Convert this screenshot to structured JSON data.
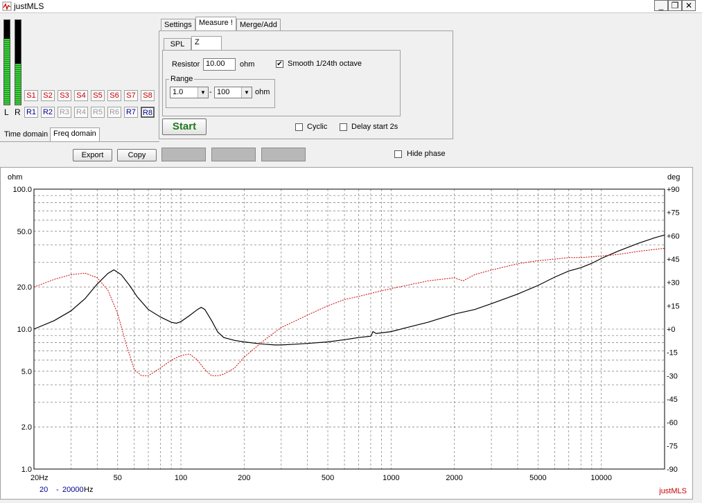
{
  "window": {
    "title": "justMLS",
    "min": "_",
    "max": "❐",
    "close": "✕"
  },
  "meters": {
    "left_label": "L",
    "right_label": "R",
    "left_level": 0.78,
    "right_level": 0.48
  },
  "sweep_buttons": [
    "S1",
    "S2",
    "S3",
    "S4",
    "S5",
    "S6",
    "S7",
    "S8"
  ],
  "ref_buttons": [
    "R1",
    "R2",
    "R3",
    "R4",
    "R5",
    "R6",
    "R7",
    "R8"
  ],
  "view_tabs": {
    "time": "Time domain",
    "freq": "Freq domain"
  },
  "main_tabs": {
    "settings": "Settings",
    "measure": "Measure !",
    "merge": "Merge/Add"
  },
  "sub_tabs": {
    "spl": "SPL",
    "z": "Z"
  },
  "z_panel": {
    "resistor_label": "Resistor",
    "resistor_value": "10.00",
    "resistor_unit": "ohm",
    "smooth_label": "Smooth 1/24th octave",
    "smooth_checked": "✔",
    "range_label": "Range",
    "range_min": "1.0",
    "range_dash": "-",
    "range_max": "100",
    "range_unit": "ohm"
  },
  "start_label": "Start",
  "cyclic_label": "Cyclic",
  "delay_label": "Delay start 2s",
  "export_label": "Export",
  "copy_label": "Copy",
  "hide_phase_label": "Hide phase",
  "plot": {
    "left_unit": "ohm",
    "right_unit": "deg",
    "y_ticks": [
      "100.0",
      "50.0",
      "20.0",
      "10.0",
      "5.0",
      "2.0",
      "1.0"
    ],
    "phase_ticks": [
      "+90",
      "+75",
      "+60",
      "+45",
      "+30",
      "+15",
      "+0",
      "-15",
      "-30",
      "-45",
      "-60",
      "-75",
      "-90"
    ],
    "x_ticks": [
      "20Hz",
      "50",
      "100",
      "200",
      "500",
      "1000",
      "2000",
      "5000",
      "10000"
    ],
    "range_from": "20",
    "range_dash": "-",
    "range_to": "20000",
    "range_unit": "Hz",
    "brand": "justMLS"
  },
  "colors": {
    "impedance": "#000000",
    "phase": "#cc0000",
    "accent_green": "#1e7a1e"
  },
  "chart_data": {
    "type": "line",
    "xlabel": "",
    "ylabel": "ohm",
    "y2label": "deg",
    "xscale": "log",
    "yscale": "log",
    "xlim": [
      20,
      20000
    ],
    "ylim": [
      1,
      100
    ],
    "y2lim": [
      -90,
      90
    ],
    "grid": true,
    "series": [
      {
        "axis": "left",
        "x": [
          20,
          25,
          30,
          35,
          40,
          45,
          48,
          52,
          57,
          62,
          70,
          80,
          90,
          95,
          100,
          110,
          120,
          125,
          130,
          140,
          150,
          160,
          180,
          200,
          230,
          250,
          280,
          300,
          350,
          400,
          500,
          600,
          700,
          800,
          820,
          850,
          900,
          1000,
          1200,
          1500,
          2000,
          2500,
          3000,
          4000,
          5000,
          6000,
          7000,
          8000,
          9000,
          10000,
          12000,
          15000,
          18000,
          20000
        ],
        "y": [
          10.0,
          11.5,
          13.5,
          16.5,
          21.0,
          25.0,
          26.5,
          24.5,
          20.5,
          17.0,
          13.8,
          12.2,
          11.2,
          11.0,
          11.3,
          12.5,
          13.8,
          14.3,
          13.8,
          11.5,
          9.5,
          8.7,
          8.3,
          8.1,
          7.9,
          7.8,
          7.7,
          7.7,
          7.8,
          7.9,
          8.1,
          8.4,
          8.7,
          8.9,
          9.6,
          9.3,
          9.4,
          9.6,
          10.3,
          11.2,
          12.8,
          13.8,
          15.2,
          17.8,
          20.5,
          23.5,
          26.0,
          27.5,
          29.5,
          32.0,
          36.0,
          41.0,
          45.0,
          47.0
        ]
      },
      {
        "axis": "right",
        "x": [
          20,
          25,
          30,
          35,
          40,
          45,
          50,
          55,
          60,
          65,
          70,
          80,
          90,
          100,
          110,
          120,
          130,
          140,
          150,
          160,
          180,
          200,
          250,
          300,
          400,
          500,
          600,
          700,
          800,
          1000,
          1500,
          2000,
          2200,
          2500,
          3000,
          4000,
          5000,
          6000,
          7000,
          8000,
          10000,
          12000,
          15000,
          20000
        ],
        "y": [
          27,
          32,
          35,
          36,
          33,
          25,
          10,
          -10,
          -26,
          -30,
          -30,
          -25,
          -20,
          -17,
          -16,
          -20,
          -26,
          -30,
          -30,
          -29,
          -25,
          -18,
          -7,
          1,
          9,
          15,
          19,
          21,
          23,
          26,
          31,
          33,
          31,
          35,
          38,
          42,
          44,
          45,
          46,
          46,
          47,
          48,
          50,
          52
        ]
      }
    ]
  }
}
